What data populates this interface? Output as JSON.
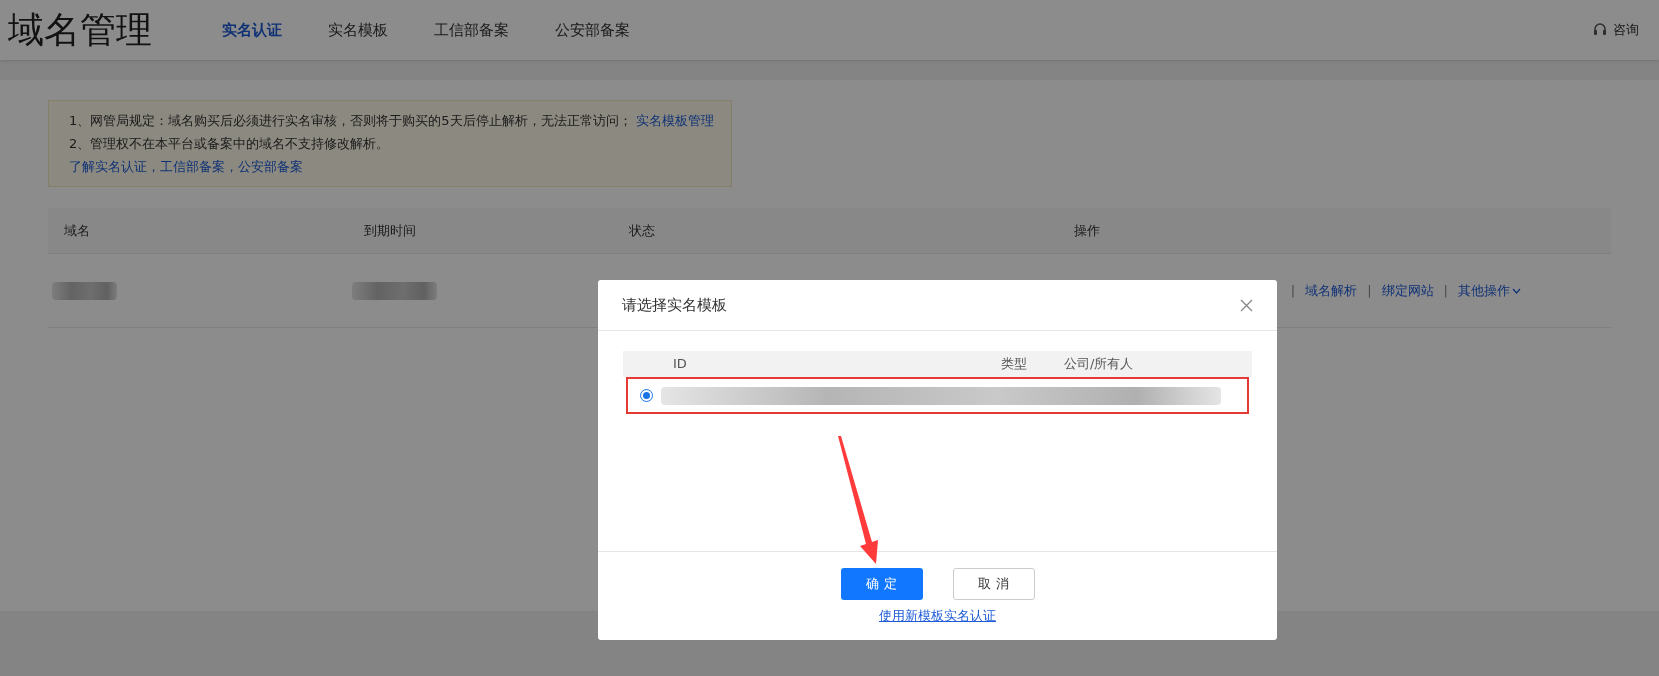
{
  "header": {
    "title": "域名管理",
    "tabs": [
      {
        "label": "实名认证",
        "selected": true
      },
      {
        "label": "实名模板",
        "selected": false
      },
      {
        "label": "工信部备案",
        "selected": false
      },
      {
        "label": "公安部备案",
        "selected": false
      }
    ],
    "help": "咨询"
  },
  "notice": {
    "line_1": "1、网管局规定：域名购买后必须进行实名审核，否则将于购买的5天后停止解析，无法正常访问；",
    "line_1_link": "实名模板管理",
    "line_2": "2、管理权不在本平台或备案中的域名不支持修改解析。",
    "line_3_link": "了解实名认证，工信部备案，公安部备案"
  },
  "table": {
    "columns": [
      "域名",
      "到期时间",
      "状态",
      "操作"
    ],
    "rows": [
      {
        "actions": [
          "域名解析",
          "绑定网站",
          "其他操作"
        ]
      }
    ],
    "separator": "|"
  },
  "dialog": {
    "title": "请选择实名模板",
    "columns": [
      "ID",
      "类型",
      "公司/所有人"
    ],
    "rows": [
      {
        "selected": true
      }
    ],
    "confirm": "确 定",
    "cancel": "取 消",
    "link": "使用新模板实名认证"
  }
}
